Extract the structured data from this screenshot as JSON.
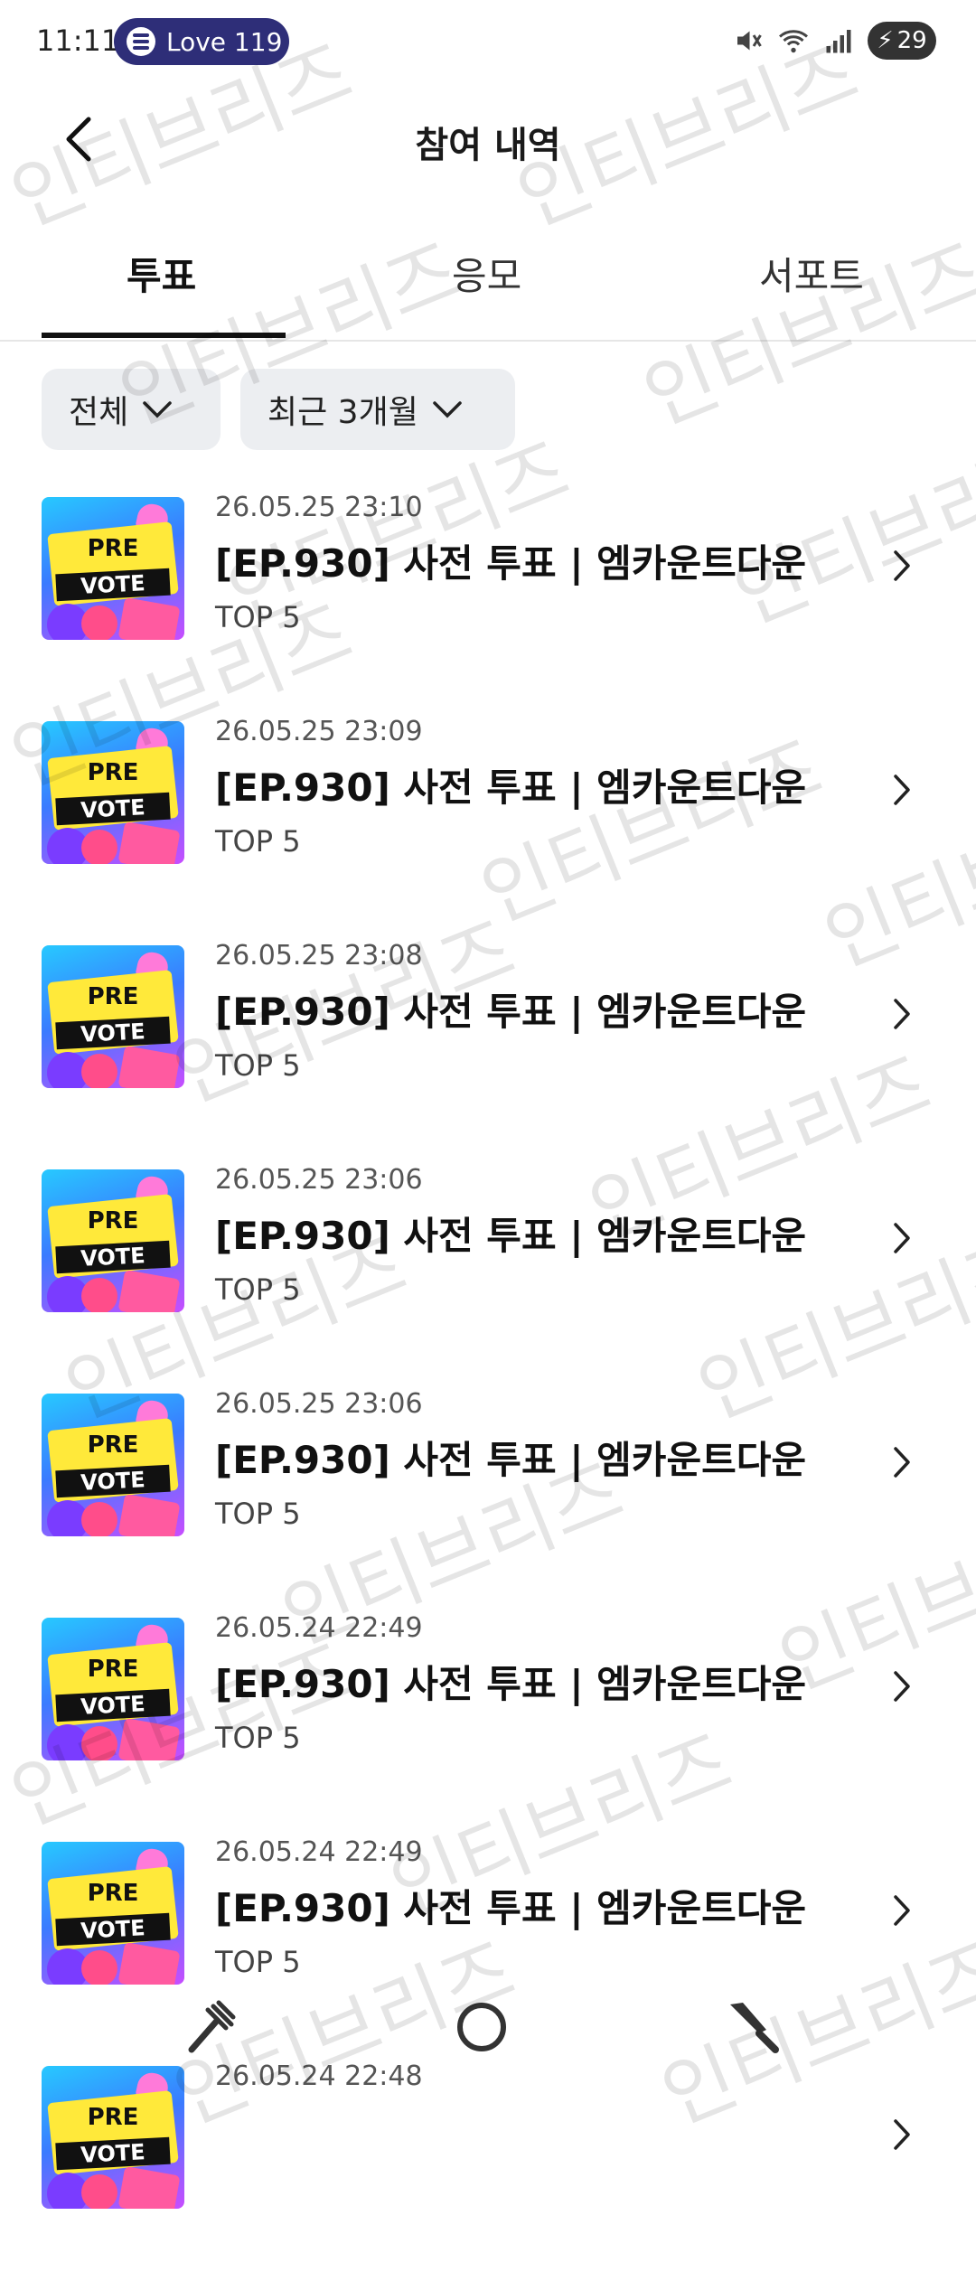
{
  "status_bar": {
    "time": "11:11",
    "media": "Love 119",
    "battery": "29"
  },
  "header": {
    "title": "참여 내역"
  },
  "tabs": [
    {
      "label": "투표",
      "active": true
    },
    {
      "label": "응모",
      "active": false
    },
    {
      "label": "서포트",
      "active": false
    }
  ],
  "filters": {
    "type": "전체",
    "period": "최근 3개월"
  },
  "thumbnail": {
    "line1": "PRE",
    "line2": "VOTE"
  },
  "items": [
    {
      "date": "26.05.25 23:10",
      "title": "[EP.930] 사전 투표 | 엠카운트다운",
      "sub": "TOP 5"
    },
    {
      "date": "26.05.25 23:09",
      "title": "[EP.930] 사전 투표 | 엠카운트다운",
      "sub": "TOP 5"
    },
    {
      "date": "26.05.25 23:08",
      "title": "[EP.930] 사전 투표 | 엠카운트다운",
      "sub": "TOP 5"
    },
    {
      "date": "26.05.25 23:06",
      "title": "[EP.930] 사전 투표 | 엠카운트다운",
      "sub": "TOP 5"
    },
    {
      "date": "26.05.25 23:06",
      "title": "[EP.930] 사전 투표 | 엠카운트다운",
      "sub": "TOP 5"
    },
    {
      "date": "26.05.24 22:49",
      "title": "[EP.930] 사전 투표 | 엠카운트다운",
      "sub": "TOP 5"
    },
    {
      "date": "26.05.24 22:49",
      "title": "[EP.930] 사전 투표 | 엠카운트다운",
      "sub": "TOP 5"
    },
    {
      "date": "26.05.24 22:48",
      "title": "",
      "sub": ""
    }
  ],
  "watermark": "인티브리즈"
}
